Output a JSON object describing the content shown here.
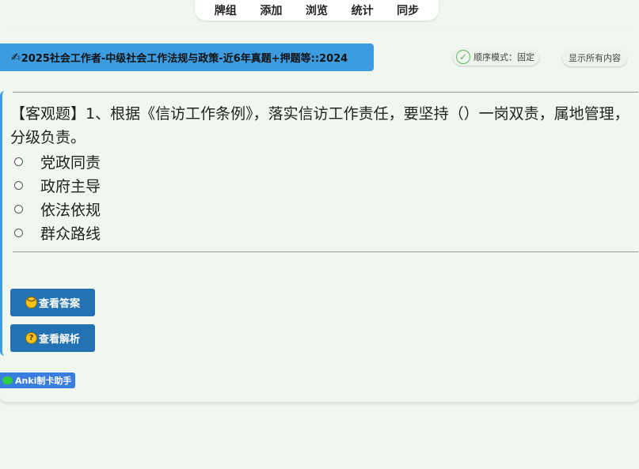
{
  "nav": {
    "items": [
      "牌组",
      "添加",
      "浏览",
      "统计",
      "同步"
    ]
  },
  "deck": {
    "title": "2025社会工作者-中级社会工作法规与政策-近6年真题+押题等::2024"
  },
  "mode": {
    "label": "顺序模式：固定"
  },
  "show_all": {
    "label": "显示所有内容"
  },
  "question": {
    "text": "【客观题】1、根据《信访工作条例》，落实信访工作责任，要坚持（）一岗双责，属地管理，分级负责。",
    "options": [
      "党政同责",
      "政府主导",
      "依法依规",
      "群众路线"
    ]
  },
  "buttons": {
    "answer": "查看答案",
    "explain": "查看解析"
  },
  "brand": {
    "label": "Anki制卡助手"
  },
  "icons": {
    "deck": "writing-hand-icon",
    "mode": "check-circle-icon",
    "answer": "worried-face-icon",
    "explain": "thinking-face-icon",
    "brand": "wechat-icon"
  },
  "colors": {
    "background": "#f0f7ee",
    "accent": "#3d9ce0",
    "button": "#2272b4",
    "check": "#5cb85c"
  }
}
